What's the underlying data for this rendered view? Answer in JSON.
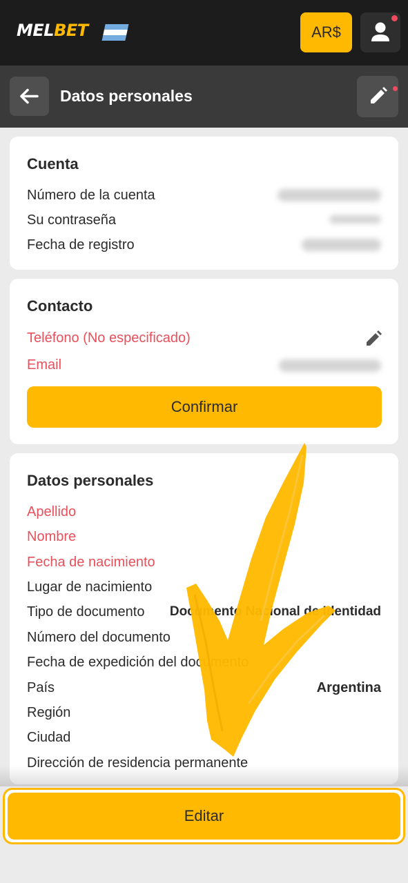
{
  "header": {
    "logo_text_a": "MEL",
    "logo_text_b": "BET",
    "flag_icon": "argentina-flag-icon",
    "currency_label": "AR$",
    "profile_icon": "user-icon",
    "notification_color": "#ef4b5c",
    "accent_color": "#ffb900"
  },
  "subheader": {
    "back_icon": "arrow-left-icon",
    "title": "Datos personales",
    "edit_icon": "pencil-icon"
  },
  "account_card": {
    "title": "Cuenta",
    "rows": [
      {
        "label": "Número de la cuenta"
      },
      {
        "label": "Su contraseña"
      },
      {
        "label": "Fecha de registro"
      }
    ]
  },
  "contact_card": {
    "title": "Contacto",
    "phone_label": "Teléfono (No especificado)",
    "email_label": "Email",
    "confirm_label": "Confirmar"
  },
  "personal_card": {
    "title": "Datos personales",
    "rows": [
      {
        "label": "Apellido",
        "value": ""
      },
      {
        "label": "Nombre",
        "value": ""
      },
      {
        "label": "Fecha de nacimiento",
        "value": ""
      },
      {
        "label": "Lugar de nacimiento",
        "value": ""
      },
      {
        "label": "Tipo de documento",
        "value": "Documento Nacional de Identidad"
      },
      {
        "label": "Número del documento",
        "value": ""
      },
      {
        "label": "Fecha de expedición del documento",
        "value": ""
      },
      {
        "label": "País",
        "value": "Argentina"
      },
      {
        "label": "Región",
        "value": ""
      },
      {
        "label": "Ciudad",
        "value": ""
      },
      {
        "label": "Dirección de residencia permanente",
        "value": ""
      }
    ]
  },
  "footer": {
    "edit_label": "Editar"
  },
  "overlay": {
    "arrow_icon": "hand-drawn-arrow-down-icon",
    "arrow_color": "#ffb900"
  }
}
